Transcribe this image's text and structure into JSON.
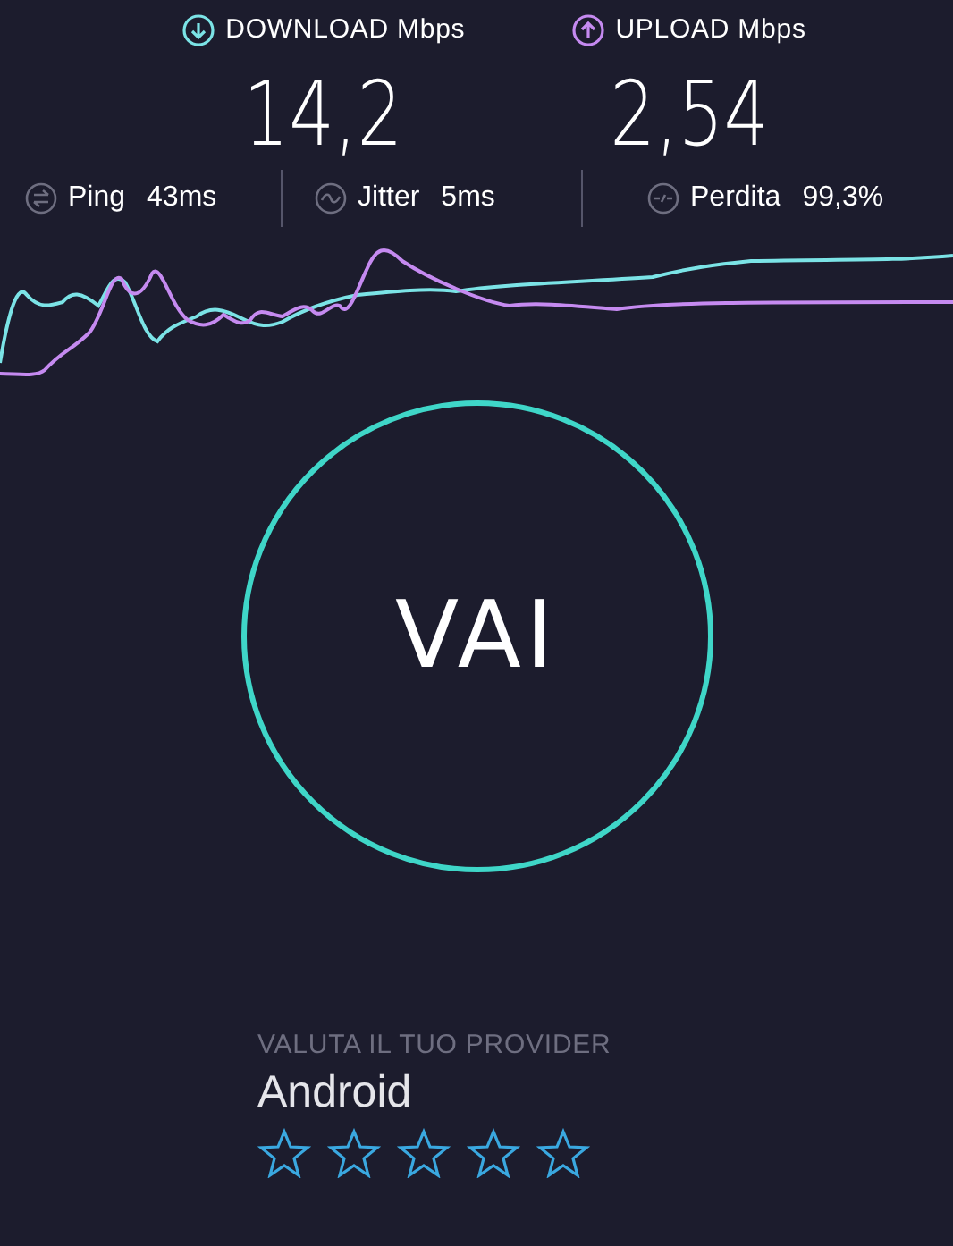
{
  "results": [
    {
      "kind": "download",
      "label": "DOWNLOAD Mbps",
      "value": "14,2"
    },
    {
      "kind": "upload",
      "label": "UPLOAD Mbps",
      "value": "2,54"
    }
  ],
  "stats": [
    {
      "kind": "ping",
      "label": "Ping",
      "value": "43ms"
    },
    {
      "kind": "jitter",
      "label": "Jitter",
      "value": "5ms"
    },
    {
      "kind": "loss",
      "label": "Perdita",
      "value": "99,3%"
    }
  ],
  "go_button": {
    "label": "VAI"
  },
  "rating": {
    "heading": "VALUTA IL TUO PROVIDER",
    "provider": "Android",
    "stars": 0
  }
}
